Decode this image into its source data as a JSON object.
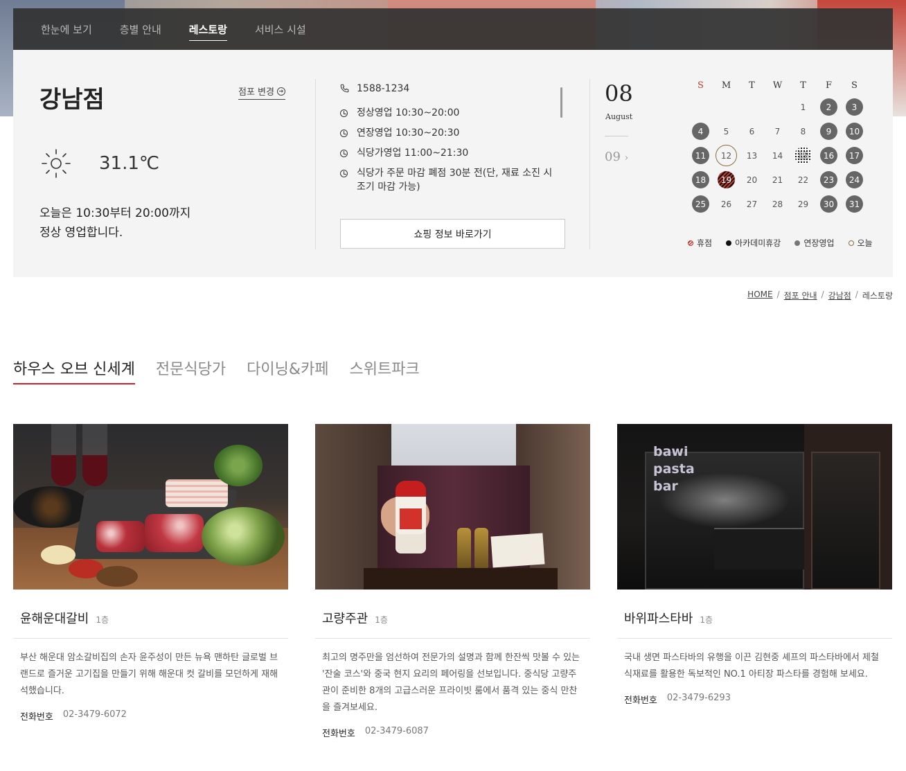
{
  "nav": {
    "items": [
      {
        "label": "한눈에 보기",
        "active": false
      },
      {
        "label": "층별 안내",
        "active": false
      },
      {
        "label": "레스토랑",
        "active": true
      },
      {
        "label": "서비스 시설",
        "active": false
      }
    ]
  },
  "store": {
    "name": "강남점",
    "change_label": "점포 변경",
    "temperature": "31.1℃",
    "weather_icon": "sun-icon",
    "open_msg_line1": "오늘은 10:30부터 20:00까지",
    "open_msg_line2": "정상 영업합니다."
  },
  "hours": {
    "phone": "1588-1234",
    "rows": [
      "정상영업 10:30~20:00",
      "연장영업 10:30~20:30",
      "식당가영업 11:00~21:30",
      "식당가 주문 마감 폐점 30분 전(단, 재료 소진 시",
      "조기 마감 가능)"
    ],
    "shop_button": "쇼핑 정보 바로가기"
  },
  "date": {
    "day": "08",
    "month": "August",
    "next": "09"
  },
  "calendar": {
    "weekdays": [
      "S",
      "M",
      "T",
      "W",
      "T",
      "F",
      "S"
    ],
    "weeks": [
      [
        {
          "n": ""
        },
        {
          "n": ""
        },
        {
          "n": ""
        },
        {
          "n": ""
        },
        {
          "n": "1",
          "t": ""
        },
        {
          "n": "2",
          "t": "ext"
        },
        {
          "n": "3",
          "t": "ext"
        }
      ],
      [
        {
          "n": "4",
          "t": "ext"
        },
        {
          "n": "5",
          "t": ""
        },
        {
          "n": "6",
          "t": ""
        },
        {
          "n": "7",
          "t": ""
        },
        {
          "n": "8",
          "t": ""
        },
        {
          "n": "9",
          "t": "ext"
        },
        {
          "n": "10",
          "t": "ext"
        }
      ],
      [
        {
          "n": "11",
          "t": "ext"
        },
        {
          "n": "12",
          "t": "today"
        },
        {
          "n": "13",
          "t": ""
        },
        {
          "n": "14",
          "t": ""
        },
        {
          "n": "15",
          "t": "academy"
        },
        {
          "n": "16",
          "t": "ext"
        },
        {
          "n": "17",
          "t": "ext"
        }
      ],
      [
        {
          "n": "18",
          "t": "ext"
        },
        {
          "n": "19",
          "t": "closed"
        },
        {
          "n": "20",
          "t": ""
        },
        {
          "n": "21",
          "t": ""
        },
        {
          "n": "22",
          "t": ""
        },
        {
          "n": "23",
          "t": "ext"
        },
        {
          "n": "24",
          "t": "ext"
        }
      ],
      [
        {
          "n": "25",
          "t": "ext"
        },
        {
          "n": "26",
          "t": ""
        },
        {
          "n": "27",
          "t": ""
        },
        {
          "n": "28",
          "t": ""
        },
        {
          "n": "29",
          "t": ""
        },
        {
          "n": "30",
          "t": "ext"
        },
        {
          "n": "31",
          "t": "ext"
        }
      ]
    ],
    "legend": {
      "closed": "휴점",
      "academy": "아카데미휴강",
      "extended": "연장영업",
      "today": "오늘"
    }
  },
  "breadcrumb": {
    "home": "HOME",
    "store_info": "점포 안내",
    "store": "강남점",
    "current": "레스토랑",
    "sep": "/"
  },
  "tabs": [
    {
      "label": "하우스 오브 신세계",
      "active": true
    },
    {
      "label": "전문식당가",
      "active": false
    },
    {
      "label": "다이닝&카페",
      "active": false
    },
    {
      "label": "스위트파크",
      "active": false
    }
  ],
  "cards": [
    {
      "name": "윤해운대갈비",
      "floor": "1층",
      "desc": "부산 해운대 암소갈비집의 손자 윤주성이 만든 뉴욕 맨하탄 글로벌 브랜드로 즐거운 고기집을 만들기 위해 해운대 컷 갈비를 모던하게 재해석했습니다.",
      "tel_label": "전화번호",
      "tel": "02-3479-6072"
    },
    {
      "name": "고량주관",
      "floor": "1층",
      "desc": "최고의 명주만을 엄선하여 전문가의 설명과 함께 한잔씩 맛볼 수 있는 '잔술 코스'와 중국 현지 요리의 페어링을 선보입니다. 중식당 고량주관이 준비한 8개의 고급스러운 프라이빗 룸에서 품격 있는 중식 만찬을 즐겨보세요.",
      "tel_label": "전화번호",
      "tel": "02-3479-6087"
    },
    {
      "name": "바위파스타바",
      "floor": "1층",
      "desc": "국내 생면 파스타바의 유행을 이끈 김현중 셰프의 파스타바에서 제철 식재료를 활용한 독보적인 NO.1 아티장 파스타를 경험해 보세요.",
      "tel_label": "전화번호",
      "tel": "02-3479-6293",
      "sign_lines": [
        "bawi",
        "pasta",
        "bar"
      ]
    }
  ]
}
